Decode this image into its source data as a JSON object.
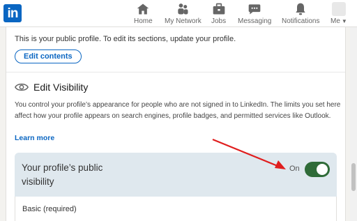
{
  "app": {
    "logo_text": "in",
    "brand_color": "#0a66c2"
  },
  "nav": {
    "items": [
      {
        "label": "Home",
        "icon": "home-icon"
      },
      {
        "label": "My Network",
        "icon": "network-icon"
      },
      {
        "label": "Jobs",
        "icon": "briefcase-icon"
      },
      {
        "label": "Messaging",
        "icon": "messaging-icon"
      },
      {
        "label": "Notifications",
        "icon": "bell-icon"
      },
      {
        "label": "Me",
        "icon": "avatar"
      }
    ]
  },
  "public_profile": {
    "intro": "This is your public profile. To edit its sections, update your profile.",
    "edit_button": "Edit contents"
  },
  "edit_visibility": {
    "icon": "eye-icon",
    "title": "Edit Visibility",
    "description": "You control your profile’s appearance for people who are not signed in to LinkedIn. The limits you set here affect how your profile appears on search engines, profile badges, and permitted services like Outlook.",
    "learn_more": "Learn more",
    "public_visibility_label": "Your profile’s public visibility",
    "toggle_state": "On",
    "toggle_color": "#2f6b38",
    "basic_label": "Basic (required)"
  },
  "annotation": {
    "arrow_color": "#e01e1e"
  }
}
